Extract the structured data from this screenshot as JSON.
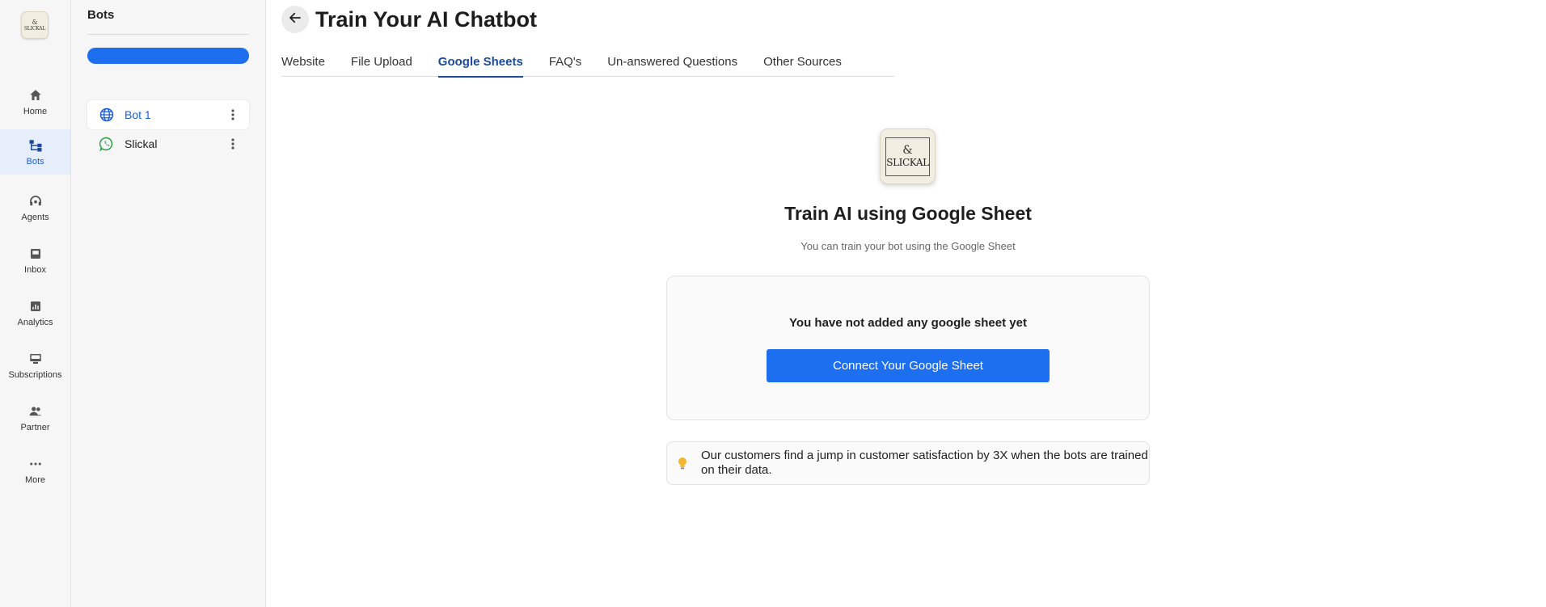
{
  "rail": {
    "logo_text": "SLICKAL",
    "items": [
      {
        "label": "Home",
        "icon": "home-icon"
      },
      {
        "label": "Bots",
        "icon": "bots-icon",
        "active": true
      },
      {
        "label": "Agents",
        "icon": "agents-icon"
      },
      {
        "label": "Inbox",
        "icon": "inbox-icon"
      },
      {
        "label": "Analytics",
        "icon": "analytics-icon"
      },
      {
        "label": "Subscriptions",
        "icon": "subscriptions-icon"
      },
      {
        "label": "Partner",
        "icon": "partner-icon"
      },
      {
        "label": "More",
        "icon": "more-icon"
      }
    ]
  },
  "bots_panel": {
    "title": "Bots",
    "bots": [
      {
        "label": "Bot 1",
        "icon": "globe-icon",
        "active": true
      },
      {
        "label": "Slickal",
        "icon": "whatsapp-icon"
      }
    ]
  },
  "header": {
    "title": "Train Your AI Chatbot"
  },
  "tabs": [
    {
      "label": "Website"
    },
    {
      "label": "File Upload"
    },
    {
      "label": "Google Sheets",
      "active": true
    },
    {
      "label": "FAQ's"
    },
    {
      "label": "Un-answered Questions"
    },
    {
      "label": "Other Sources"
    }
  ],
  "main": {
    "logo_text": "SLICKAL",
    "heading": "Train AI using Google Sheet",
    "subheading": "You can train your bot using the Google Sheet",
    "empty_text": "You have not added any google sheet yet",
    "connect_label": "Connect Your Google Sheet",
    "tip_text": "Our customers find a jump in customer satisfaction by 3X when the bots are trained on their data."
  },
  "colors": {
    "accent": "#1e6ef0",
    "active_tab": "#1d4a9c",
    "rail_active_bg": "#e6eefb",
    "whatsapp": "#25a244"
  }
}
